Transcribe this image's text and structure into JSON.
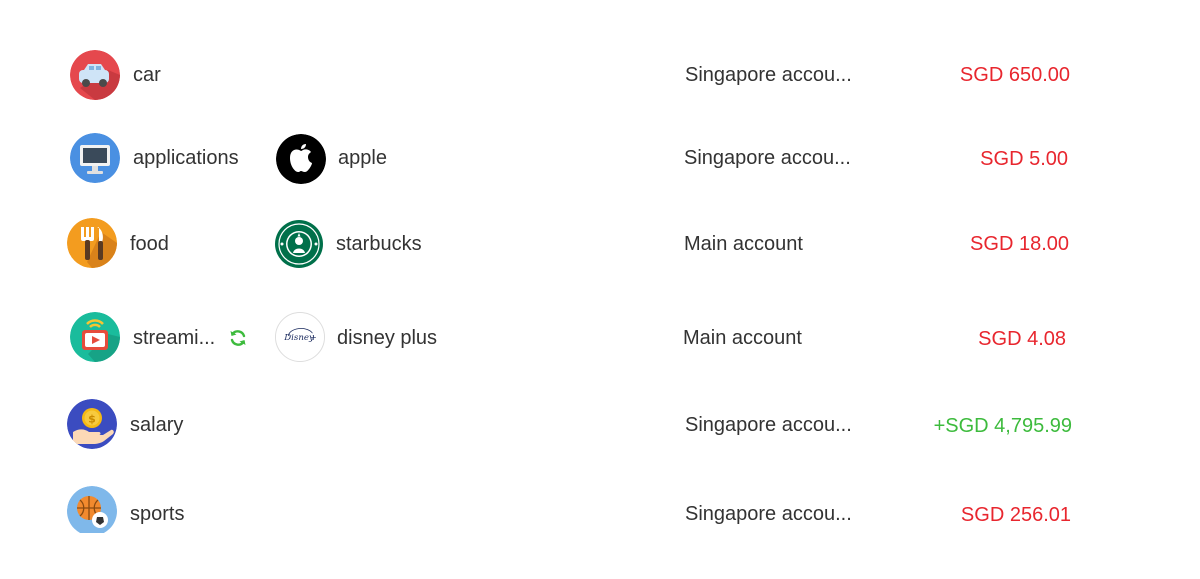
{
  "transactions": [
    {
      "category": "car",
      "category_icon": "car-icon",
      "merchant": "",
      "account": "Singapore accou...",
      "amount": "SGD 650.00",
      "type": "expense"
    },
    {
      "category": "applications",
      "category_icon": "computer-monitor-icon",
      "merchant": "apple",
      "merchant_icon": "apple-logo-icon",
      "account": "Singapore accou...",
      "amount": "SGD 5.00",
      "type": "expense"
    },
    {
      "category": "food",
      "category_icon": "fork-knife-icon",
      "merchant": "starbucks",
      "merchant_icon": "starbucks-logo-icon",
      "account": "Main account",
      "amount": "SGD 18.00",
      "type": "expense"
    },
    {
      "category": "streami...",
      "category_icon": "streaming-tv-icon",
      "recurring_icon": "recurring-refresh-icon",
      "merchant": "disney plus",
      "merchant_icon": "disney-plus-logo-icon",
      "account": "Main account",
      "amount": "SGD 4.08",
      "type": "expense"
    },
    {
      "category": "salary",
      "category_icon": "salary-coin-hand-icon",
      "merchant": "",
      "account": "Singapore accou...",
      "amount": "+SGD 4,795.99",
      "type": "income"
    },
    {
      "category": "sports",
      "category_icon": "sports-balls-icon",
      "merchant": "",
      "account": "Singapore accou...",
      "amount": "SGD 256.01",
      "type": "expense"
    }
  ],
  "colors": {
    "expense": "#e8262e",
    "income": "#3dbb3d",
    "recurring": "#3dbb3d"
  }
}
